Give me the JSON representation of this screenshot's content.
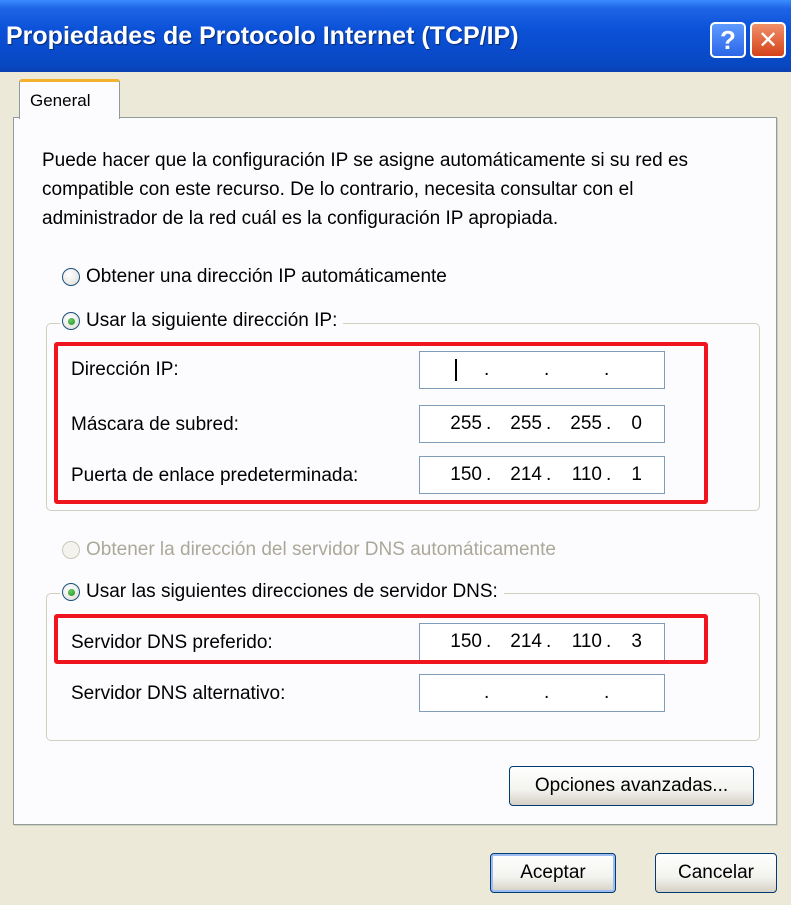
{
  "window": {
    "title": "Propiedades de Protocolo Internet (TCP/IP)",
    "help_glyph": "?",
    "close_glyph": "✕"
  },
  "tabs": [
    {
      "label": "General"
    }
  ],
  "description": "Puede hacer que la configuración IP se asigne automáticamente si su red es compatible con este recurso. De lo contrario, necesita consultar con el administrador de la red cuál es la configuración IP apropiada.",
  "ip_mode": {
    "auto_label": "Obtener una dirección IP automáticamente",
    "manual_label": "Usar la siguiente dirección IP:",
    "selected": "manual"
  },
  "ip_fields": {
    "ip_address": {
      "label": "Dirección IP:",
      "octets": [
        "",
        "",
        "",
        ""
      ]
    },
    "subnet_mask": {
      "label": "Máscara de subred:",
      "octets": [
        "255",
        "255",
        "255",
        "0"
      ]
    },
    "gateway": {
      "label": "Puerta de enlace predeterminada:",
      "octets": [
        "150",
        "214",
        "110",
        "1"
      ]
    }
  },
  "dns_mode": {
    "auto_label": "Obtener la dirección del servidor DNS automáticamente",
    "manual_label": "Usar las siguientes direcciones de servidor DNS:",
    "selected": "manual",
    "auto_disabled": true
  },
  "dns_fields": {
    "preferred": {
      "label": "Servidor DNS preferido:",
      "octets": [
        "150",
        "214",
        "110",
        "3"
      ]
    },
    "alternate": {
      "label": "Servidor DNS alternativo:",
      "octets": [
        "",
        "",
        "",
        ""
      ]
    }
  },
  "buttons": {
    "advanced": "Opciones avanzadas...",
    "ok": "Aceptar",
    "cancel": "Cancelar"
  },
  "colors": {
    "highlight_border": "#F0141E",
    "titlebar": "#0A4BCC",
    "dialog_bg": "#ECE9D8"
  }
}
